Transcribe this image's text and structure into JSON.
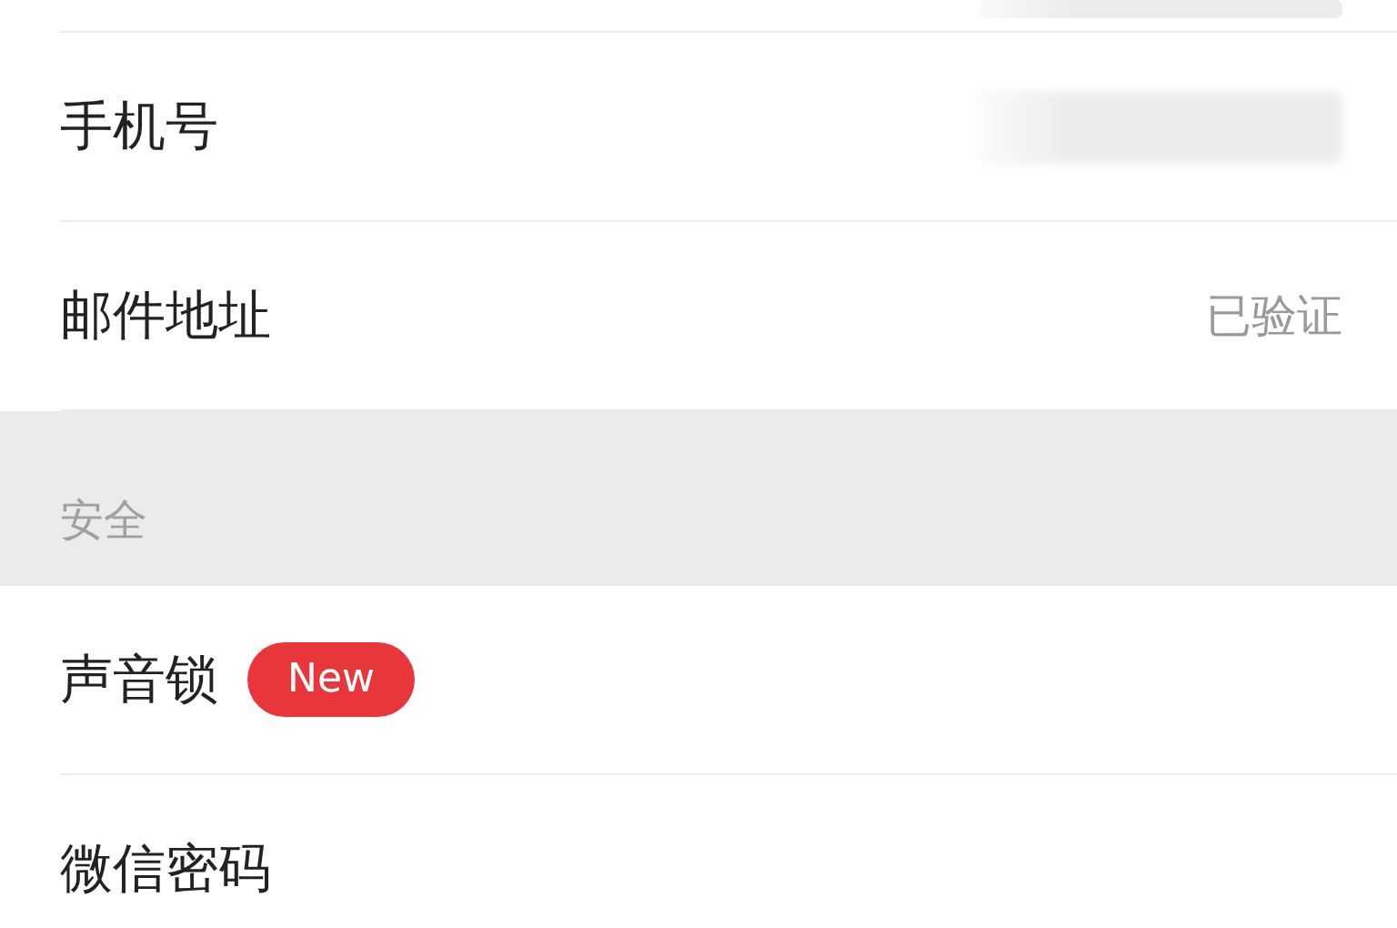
{
  "sections": [
    {
      "rows": [
        {
          "value_redacted": true
        },
        {
          "label": "手机号",
          "value_redacted": true
        },
        {
          "label": "邮件地址",
          "value": "已验证"
        }
      ]
    },
    {
      "header": "安全",
      "rows": [
        {
          "label": "声音锁",
          "badge": "New"
        },
        {
          "label": "微信密码"
        }
      ]
    }
  ]
}
